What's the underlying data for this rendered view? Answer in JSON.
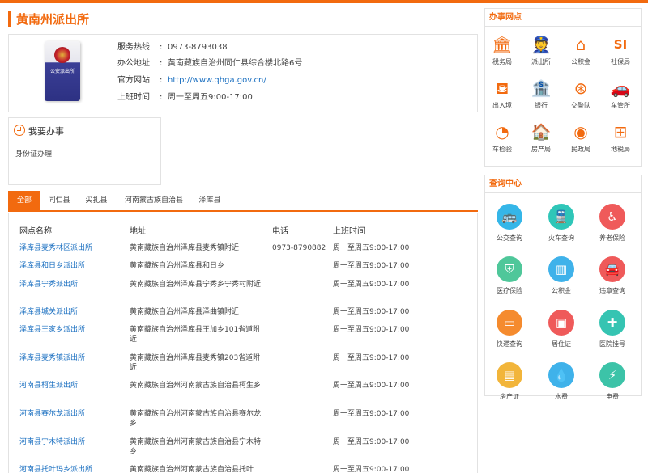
{
  "page": {
    "title": "黄南州派出所"
  },
  "station": {
    "badge_text": "公安派出所",
    "rows": [
      {
        "label": "服务热线",
        "value": "0973-8793038",
        "link": false
      },
      {
        "label": "办公地址",
        "value": "黄南藏族自治州同仁县综合楼北路6号",
        "link": false
      },
      {
        "label": "官方网站",
        "value": "http://www.qhga.gov.cn/",
        "link": true
      },
      {
        "label": "上班时间",
        "value": "周一至周五9:00-17:00",
        "link": false
      }
    ]
  },
  "service": {
    "heading": "我要办事",
    "item": "身份证办理"
  },
  "tabs": [
    "全部",
    "同仁县",
    "尖扎县",
    "河南蒙古族自治县",
    "泽库县"
  ],
  "active_tab": 0,
  "table": {
    "headers": [
      "网点名称",
      "地址",
      "电话",
      "上班时间"
    ],
    "rows": [
      {
        "name": "泽库县麦秀林区派出所",
        "address": "黄南藏族自治州泽库县麦秀镇附近",
        "phone": "0973-8790882",
        "time": "周一至周五9:00-17:00"
      },
      {
        "name": "泽库县和日乡派出所",
        "address": "黄南藏族自治州泽库县和日乡",
        "phone": "",
        "time": "周一至周五9:00-17:00"
      },
      {
        "name": "泽库县宁秀派出所",
        "address": "黄南藏族自治州泽库县宁秀乡宁秀村附近",
        "phone": "",
        "time": "周一至周五9:00-17:00"
      },
      {
        "name": "泽库县城关派出所",
        "address": "黄南藏族自治州泽库县泽曲镇附近",
        "phone": "",
        "time": "周一至周五9:00-17:00"
      },
      {
        "name": "泽库县王家乡派出所",
        "address": "黄南藏族自治州泽库县王加乡101省道附近",
        "phone": "",
        "time": "周一至周五9:00-17:00"
      },
      {
        "name": "泽库县麦秀镇派出所",
        "address": "黄南藏族自治州泽库县麦秀镇203省道附近",
        "phone": "",
        "time": "周一至周五9:00-17:00"
      },
      {
        "name": "河南县柯生派出所",
        "address": "黄南藏族自治州河南蒙古族自治县柯生乡",
        "phone": "",
        "time": "周一至周五9:00-17:00"
      },
      {
        "name": "河南县赛尔龙派出所",
        "address": "黄南藏族自治州河南蒙古族自治县赛尔龙乡",
        "phone": "",
        "time": "周一至周五9:00-17:00"
      },
      {
        "name": "河南县宁木特派出所",
        "address": "黄南藏族自治州河南蒙古族自治县宁木特乡",
        "phone": "",
        "time": "周一至周五9:00-17:00"
      },
      {
        "name": "河南县托叶玛乡派出所",
        "address": "黄南藏族自治州河南蒙古族自治县托叶",
        "phone": "",
        "time": "周一至周五9:00-17:00"
      }
    ]
  },
  "sidebar_service": {
    "heading": "办事网点",
    "items": [
      {
        "label": "税务局",
        "icon": "bank-icon"
      },
      {
        "label": "派出所",
        "icon": "police-icon"
      },
      {
        "label": "公积金",
        "icon": "house-fund-icon"
      },
      {
        "label": "社保局",
        "icon": "social-security-icon"
      },
      {
        "label": "出入境",
        "icon": "immigration-icon"
      },
      {
        "label": "银行",
        "icon": "bank-building-icon"
      },
      {
        "label": "交警队",
        "icon": "steering-wheel-icon"
      },
      {
        "label": "车管所",
        "icon": "car-icon"
      },
      {
        "label": "车检验",
        "icon": "gauge-icon"
      },
      {
        "label": "房产局",
        "icon": "home-icon"
      },
      {
        "label": "民政局",
        "icon": "civil-affairs-icon"
      },
      {
        "label": "地税局",
        "icon": "tax-office-icon"
      }
    ]
  },
  "sidebar_query": {
    "heading": "查询中心",
    "items": [
      {
        "label": "公交查询",
        "icon": "bus-icon",
        "color": "#35b6e8"
      },
      {
        "label": "火车查询",
        "icon": "train-icon",
        "color": "#2fc6b8"
      },
      {
        "label": "养老保险",
        "icon": "elderly-icon",
        "color": "#ef5a5a"
      },
      {
        "label": "医疗保险",
        "icon": "medical-shield-icon",
        "color": "#4fc79a"
      },
      {
        "label": "公积金",
        "icon": "chart-icon",
        "color": "#3fb2ea"
      },
      {
        "label": "违章查询",
        "icon": "car-violation-icon",
        "color": "#ef5a5a"
      },
      {
        "label": "快递查询",
        "icon": "express-icon",
        "color": "#f58b2e"
      },
      {
        "label": "居住证",
        "icon": "id-card-icon",
        "color": "#ef5a5a"
      },
      {
        "label": "医院挂号",
        "icon": "hospital-icon",
        "color": "#35c4b2"
      },
      {
        "label": "房产证",
        "icon": "building-icon",
        "color": "#f2b53a"
      },
      {
        "label": "水费",
        "icon": "water-icon",
        "color": "#3fb2ea"
      },
      {
        "label": "电费",
        "icon": "electricity-icon",
        "color": "#3cc3a8"
      }
    ]
  }
}
